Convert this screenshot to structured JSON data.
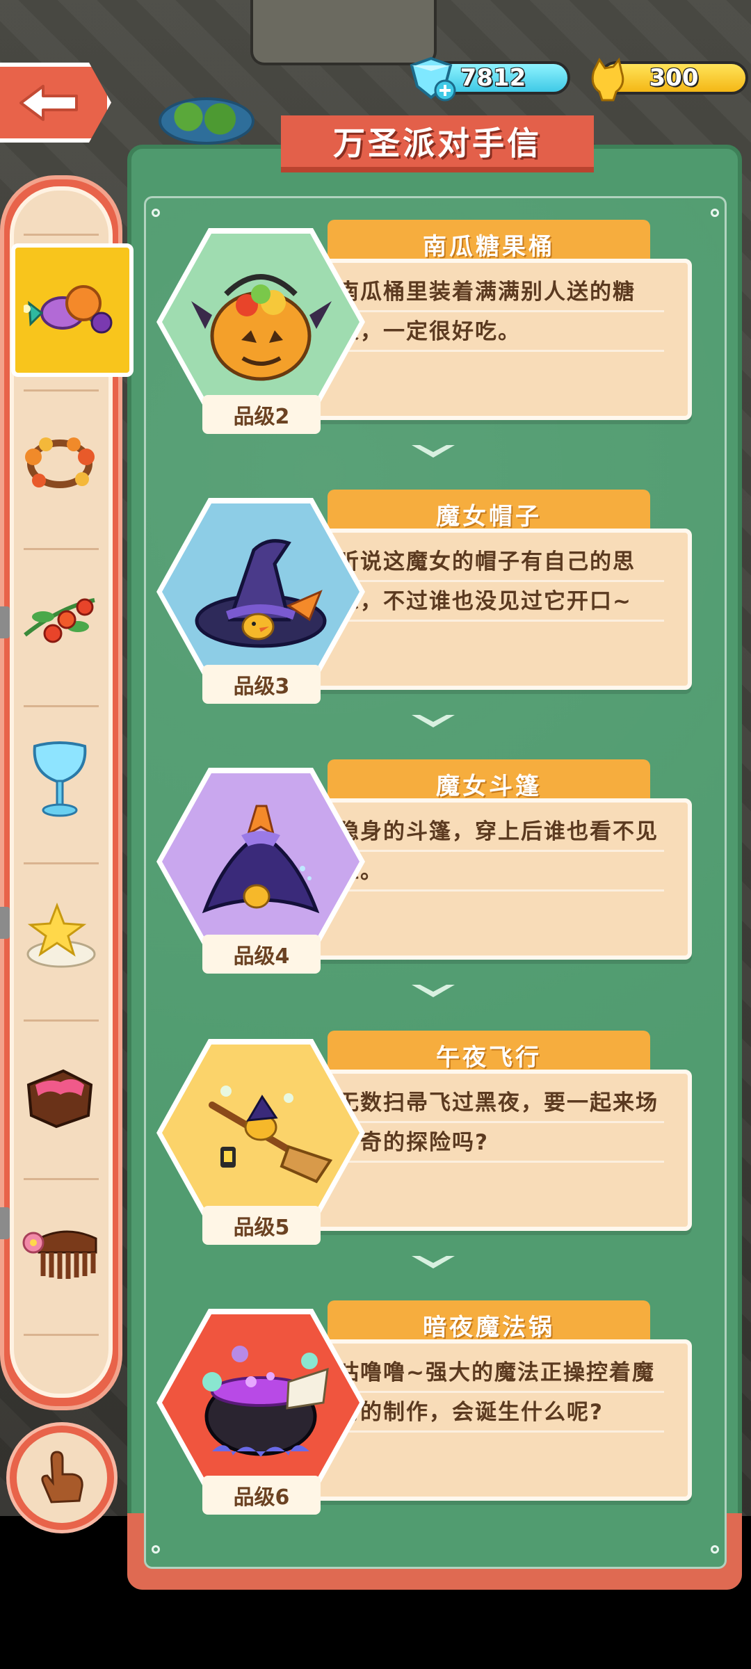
{
  "currency": {
    "gems": "7812",
    "gold": "300"
  },
  "panel": {
    "title": "万圣派对手信"
  },
  "sidebar": {
    "items": [
      {
        "icon": "candy-icon",
        "selected": true
      },
      {
        "icon": "autumn-wreath-icon"
      },
      {
        "icon": "berry-branch-icon"
      },
      {
        "icon": "crystal-goblet-icon"
      },
      {
        "icon": "star-cloud-icon"
      },
      {
        "icon": "chocolate-cake-icon"
      },
      {
        "icon": "flower-comb-icon"
      }
    ],
    "hand_button": "hand-pointer-icon"
  },
  "cards": [
    {
      "name": "南瓜糖果桶",
      "desc": "南瓜桶里装着满满别人送的糖果，一定很好吃。",
      "grade": "品级2",
      "icon": "pumpkin-candy-bucket-icon",
      "bg": "#9fdcb0"
    },
    {
      "name": "魔女帽子",
      "desc": "听说这魔女的帽子有自己的思想，不过谁也没见过它开口~",
      "grade": "品级3",
      "icon": "witch-hat-icon",
      "bg": "#8dcde6"
    },
    {
      "name": "魔女斗篷",
      "desc": "隐身的斗篷，穿上后谁也看不见谁。",
      "grade": "品级4",
      "icon": "witch-cloak-icon",
      "bg": "#c9a7ee"
    },
    {
      "name": "午夜飞行",
      "desc": "无数扫帚飞过黑夜，要一起来场神奇的探险吗?",
      "grade": "品级5",
      "icon": "midnight-broom-icon",
      "bg": "#fbd36a"
    },
    {
      "name": "暗夜魔法锅",
      "desc": "咕噜噜~强大的魔法正操控着魔药的制作，会诞生什么呢?",
      "grade": "品级6",
      "icon": "magic-cauldron-icon",
      "bg": "#f0553e"
    }
  ],
  "colors": {
    "panel_green": "#519c70",
    "accent_red": "#e3604a",
    "tab_orange": "#f6ad3e",
    "desc_bg": "#f8dcb8"
  }
}
